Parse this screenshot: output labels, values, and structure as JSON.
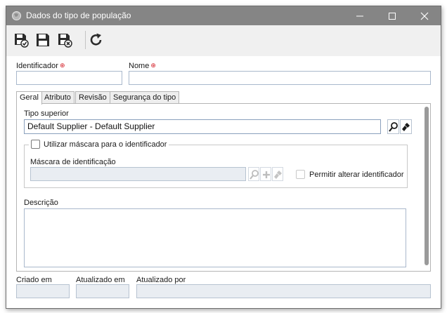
{
  "window": {
    "title": "Dados do tipo de população"
  },
  "toolbar": {
    "save_new_icon": "save-new-icon",
    "save_icon": "save-icon",
    "save_close_icon": "save-close-icon",
    "refresh_icon": "refresh-icon"
  },
  "form": {
    "identificador_label": "Identificador",
    "identificador_value": "",
    "nome_label": "Nome",
    "nome_value": "",
    "required_marker": "⊕"
  },
  "tabs": [
    {
      "label": "Geral",
      "active": true
    },
    {
      "label": "Atributo",
      "active": false
    },
    {
      "label": "Revisão",
      "active": false
    },
    {
      "label": "Segurança do tipo",
      "active": false
    }
  ],
  "geral": {
    "tipo_superior_label": "Tipo superior",
    "tipo_superior_value": "Default Supplier - Default Supplier",
    "mask_checkbox_label": "Utilizar máscara para o identificador",
    "mask_checkbox_checked": false,
    "mask_label": "Máscara de identificação",
    "mask_value": "",
    "allow_change_label": "Permitir alterar identificador",
    "allow_change_checked": false,
    "descricao_label": "Descrição",
    "descricao_value": ""
  },
  "footer": {
    "criado_em_label": "Criado em",
    "criado_em_value": "",
    "atualizado_em_label": "Atualizado em",
    "atualizado_em_value": "",
    "atualizado_por_label": "Atualizado por",
    "atualizado_por_value": ""
  },
  "colors": {
    "titlebar": "#858585",
    "required": "#d4232b",
    "field_border": "#a9b8cc"
  }
}
